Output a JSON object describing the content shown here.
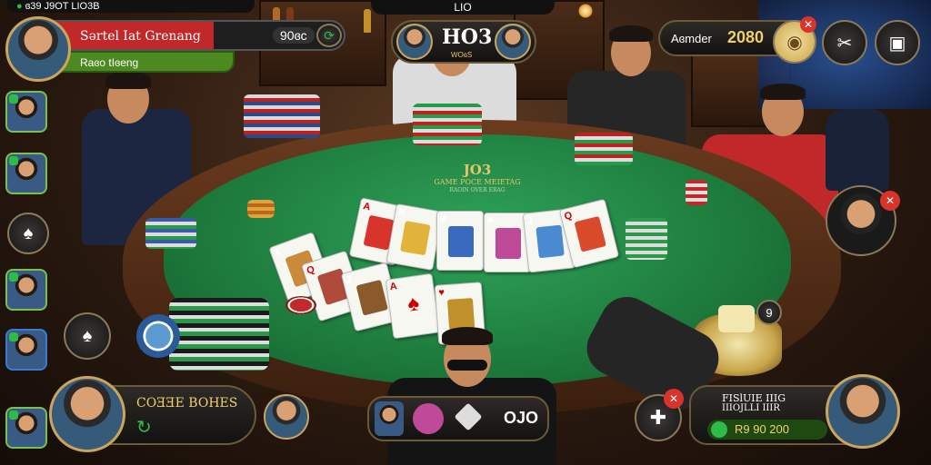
{
  "top_status": {
    "text": "ɞ39 J9OT LIO3B"
  },
  "top_center": {
    "label": "LIO"
  },
  "player_panel": {
    "name": "Sərtel Iat Grenang",
    "amount": "90ɞc",
    "subtitle": "Raɞo tIɞeng"
  },
  "room_badge": {
    "title": "HO3",
    "sub": "WOɞS"
  },
  "balance": {
    "label": "Aɞmder",
    "amount": "2080"
  },
  "felt": {
    "logo": "JO3",
    "title": "GAME POCE MEIETAG",
    "small": "RAOIN OVER ERAG"
  },
  "timer": {
    "value": "9"
  },
  "bottom_left_panel": {
    "label": "COƎƎE BOHES"
  },
  "bottom_center_panel": {
    "value": "OJO"
  },
  "bottom_right_panel": {
    "title": "FISlUIE IIIG",
    "sub": "IIIOJLLI IIIR",
    "amount": "R9 90 200"
  },
  "colors": {
    "felt": "#1d7a3c",
    "gold": "#caa55a",
    "red": "#c0282a",
    "green_accent": "#2dbb4a"
  },
  "icons": [
    "crossed-tools-icon",
    "chat-icon",
    "gear-icon",
    "share-icon",
    "spade-icon",
    "close-icon"
  ]
}
